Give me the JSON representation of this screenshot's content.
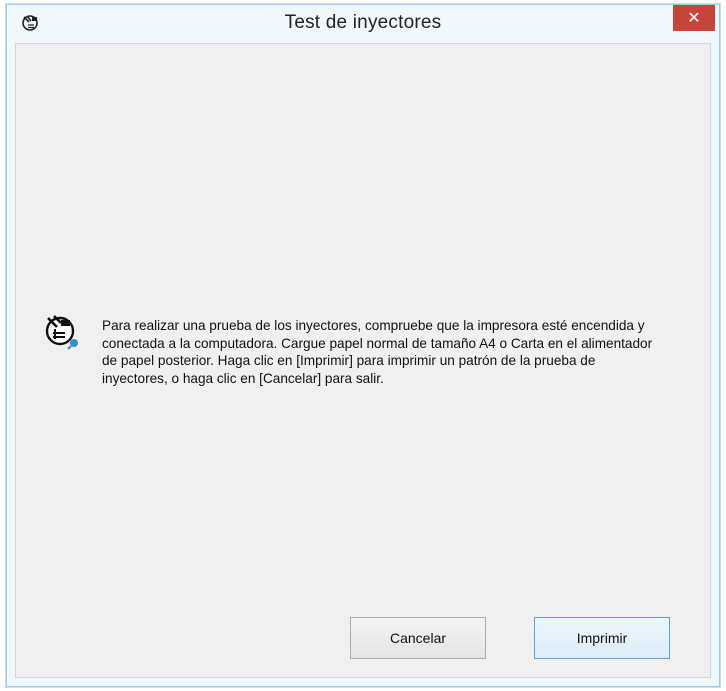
{
  "window": {
    "title": "Test de inyectores"
  },
  "icons": {
    "app": "nozzle-check-icon",
    "close": "close-icon",
    "message": "nozzle-check-magnifier-icon"
  },
  "colors": {
    "close_button": "#c7443b",
    "window_border": "#9ccbe3",
    "background": "#f0f0f0"
  },
  "message": {
    "text": "Para realizar una prueba de los inyectores, compruebe que la impresora esté encendida y conectada a la computadora. Cargue papel normal de tamaño A4 o Carta en el alimentador de papel posterior. Haga clic en [Imprimir] para imprimir un patrón de la prueba de inyectores, o haga clic en [Cancelar] para salir."
  },
  "buttons": {
    "cancel_label": "Cancelar",
    "print_label": "Imprimir"
  }
}
